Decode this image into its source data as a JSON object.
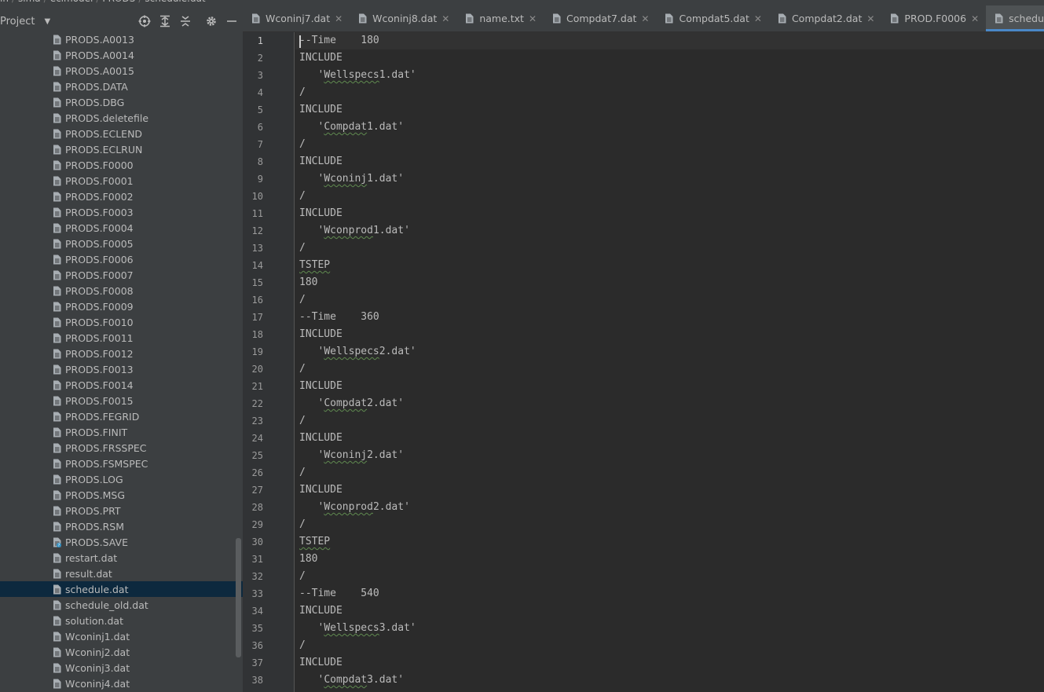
{
  "breadcrumb": [
    "in",
    "sima",
    "eclmodel",
    "PRODS",
    "schedule.dat"
  ],
  "project_panel": {
    "title": "Project",
    "tree": [
      {
        "label": "PRODS.A0013"
      },
      {
        "label": "PRODS.A0014"
      },
      {
        "label": "PRODS.A0015"
      },
      {
        "label": "PRODS.DATA"
      },
      {
        "label": "PRODS.DBG"
      },
      {
        "label": "PRODS.deletefile"
      },
      {
        "label": "PRODS.ECLEND"
      },
      {
        "label": "PRODS.ECLRUN"
      },
      {
        "label": "PRODS.F0000"
      },
      {
        "label": "PRODS.F0001"
      },
      {
        "label": "PRODS.F0002"
      },
      {
        "label": "PRODS.F0003"
      },
      {
        "label": "PRODS.F0004"
      },
      {
        "label": "PRODS.F0005"
      },
      {
        "label": "PRODS.F0006"
      },
      {
        "label": "PRODS.F0007"
      },
      {
        "label": "PRODS.F0008"
      },
      {
        "label": "PRODS.F0009"
      },
      {
        "label": "PRODS.F0010"
      },
      {
        "label": "PRODS.F0011"
      },
      {
        "label": "PRODS.F0012"
      },
      {
        "label": "PRODS.F0013"
      },
      {
        "label": "PRODS.F0014"
      },
      {
        "label": "PRODS.F0015"
      },
      {
        "label": "PRODS.FEGRID"
      },
      {
        "label": "PRODS.FINIT"
      },
      {
        "label": "PRODS.FRSSPEC"
      },
      {
        "label": "PRODS.FSMSPEC"
      },
      {
        "label": "PRODS.LOG"
      },
      {
        "label": "PRODS.MSG"
      },
      {
        "label": "PRODS.PRT"
      },
      {
        "label": "PRODS.RSM"
      },
      {
        "label": "PRODS.SAVE",
        "unknown": true
      },
      {
        "label": "restart.dat"
      },
      {
        "label": "result.dat"
      },
      {
        "label": "schedule.dat",
        "selected": true
      },
      {
        "label": "schedule_old.dat"
      },
      {
        "label": "solution.dat"
      },
      {
        "label": "Wconinj1.dat"
      },
      {
        "label": "Wconinj2.dat"
      },
      {
        "label": "Wconinj3.dat"
      },
      {
        "label": "Wconinj4.dat"
      }
    ]
  },
  "tabs": [
    {
      "label": "Wconinj7.dat"
    },
    {
      "label": "Wconinj8.dat"
    },
    {
      "label": "name.txt"
    },
    {
      "label": "Compdat7.dat"
    },
    {
      "label": "Compdat5.dat"
    },
    {
      "label": "Compdat2.dat"
    },
    {
      "label": "PROD.F0006"
    },
    {
      "label": "schedule.dat",
      "active": true
    }
  ],
  "editor": {
    "lines": [
      {
        "n": "1",
        "text": "--Time    180"
      },
      {
        "n": "2",
        "text": "INCLUDE"
      },
      {
        "n": "3",
        "text": "   'Wellspecs1.dat'",
        "squiggle": "Wellspecs"
      },
      {
        "n": "4",
        "text": "/"
      },
      {
        "n": "5",
        "text": "INCLUDE"
      },
      {
        "n": "6",
        "text": "   'Compdat1.dat'",
        "squiggle": "Compdat"
      },
      {
        "n": "7",
        "text": "/"
      },
      {
        "n": "8",
        "text": "INCLUDE"
      },
      {
        "n": "9",
        "text": "   'Wconinj1.dat'",
        "squiggle": "Wconinj"
      },
      {
        "n": "10",
        "text": "/"
      },
      {
        "n": "11",
        "text": "INCLUDE"
      },
      {
        "n": "12",
        "text": "   'Wconprod1.dat'",
        "squiggle": "Wconprod"
      },
      {
        "n": "13",
        "text": "/"
      },
      {
        "n": "14",
        "text": "TSTEP",
        "squiggle": "TSTEP"
      },
      {
        "n": "15",
        "text": "180"
      },
      {
        "n": "16",
        "text": "/"
      },
      {
        "n": "17",
        "text": "--Time    360"
      },
      {
        "n": "18",
        "text": "INCLUDE"
      },
      {
        "n": "19",
        "text": "   'Wellspecs2.dat'",
        "squiggle": "Wellspecs"
      },
      {
        "n": "20",
        "text": "/"
      },
      {
        "n": "21",
        "text": "INCLUDE"
      },
      {
        "n": "22",
        "text": "   'Compdat2.dat'",
        "squiggle": "Compdat"
      },
      {
        "n": "23",
        "text": "/"
      },
      {
        "n": "24",
        "text": "INCLUDE"
      },
      {
        "n": "25",
        "text": "   'Wconinj2.dat'",
        "squiggle": "Wconinj"
      },
      {
        "n": "26",
        "text": "/"
      },
      {
        "n": "27",
        "text": "INCLUDE"
      },
      {
        "n": "28",
        "text": "   'Wconprod2.dat'",
        "squiggle": "Wconprod"
      },
      {
        "n": "29",
        "text": "/"
      },
      {
        "n": "30",
        "text": "TSTEP",
        "squiggle": "TSTEP"
      },
      {
        "n": "31",
        "text": "180"
      },
      {
        "n": "32",
        "text": "/"
      },
      {
        "n": "33",
        "text": "--Time    540"
      },
      {
        "n": "34",
        "text": "INCLUDE"
      },
      {
        "n": "35",
        "text": "   'Wellspecs3.dat'",
        "squiggle": "Wellspecs"
      },
      {
        "n": "36",
        "text": "/"
      },
      {
        "n": "37",
        "text": "INCLUDE"
      },
      {
        "n": "38",
        "text": "   'Compdat3.dat'",
        "squiggle": "Compdat"
      }
    ]
  },
  "icons": {
    "locate": "crosshair-icon",
    "expand": "expand-all-icon",
    "collapse": "collapse-all-icon",
    "settings": "gear-icon",
    "hide": "minimize-icon",
    "file": "file-icon",
    "tab_close": "close-icon"
  },
  "colors": {
    "panel_bg": "#3c3f41",
    "editor_bg": "#2b2b2b",
    "gutter_bg": "#313335",
    "selection": "#0d293e",
    "tab_accent": "#4a88c7",
    "text": "#bbbbbb"
  }
}
